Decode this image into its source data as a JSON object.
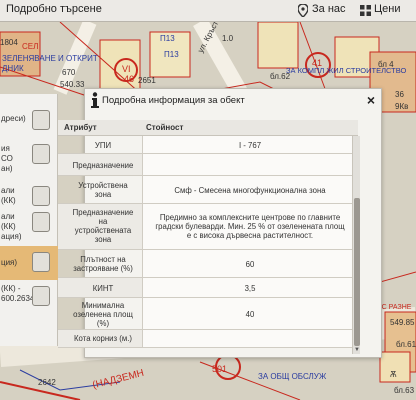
{
  "topbar": {
    "title": "Подробно търсене",
    "about_label": "За нас",
    "prices_label": "Цени"
  },
  "map_labels": {
    "l1": "1804",
    "l2": "СЕЛ",
    "l3": "ЗЕЛЕНЯВАНЕ И ОТКРИТ",
    "l4": "ДНИК",
    "l5": "670",
    "l6": "540.33",
    "l7": "П13",
    "l8": "П13",
    "l9": "ул. Кръсто Пастух",
    "l10": "VI",
    "l11": "46",
    "l12": "2651",
    "l13": "1.0",
    "l14": "41",
    "l15": "ЗА КОМПЛ ЖИЛ СТРОИТЕЛСТВО",
    "l16": "бл.62",
    "l17": "бл 4",
    "l18": "2642",
    "l19": "(НАДЗЕМН",
    "l20": "501",
    "l21": "ЗА ОБЩ ОБСЛУЖ",
    "l22": "Ѫ",
    "l23": "549.85",
    "l24": "бл.61",
    "l25": "НЕ С РАЗНЕ",
    "l26": "бл.63",
    "l27": "36",
    "l28": "9Кв"
  },
  "left_panel": {
    "items": [
      {
        "lines": [
          "дреси)"
        ]
      },
      {
        "lines": [
          "ия",
          "СО",
          "ан)"
        ]
      },
      {
        "lines": [
          "али",
          "(КК)"
        ]
      },
      {
        "lines": [
          "али",
          "(КК)",
          "ация)"
        ]
      },
      {
        "lines": [
          "ция)"
        ]
      },
      {
        "lines": [
          "(КК) -",
          "600.2634"
        ]
      }
    ]
  },
  "dialog": {
    "title": "Подробна информация за обект",
    "close": "×",
    "col_attr": "Атрибут",
    "col_val": "Стойност",
    "rows": [
      {
        "attr": [
          "УПИ"
        ],
        "value": [
          "I - 767"
        ]
      },
      {
        "attr": [
          "Предназначение"
        ],
        "value": [
          ""
        ]
      },
      {
        "attr": [
          "Устройствена",
          "зона"
        ],
        "value": [
          "Смф - Смесена многофункционална зона"
        ]
      },
      {
        "attr": [
          "Предназначение",
          "на",
          "устройствената",
          "зона"
        ],
        "value": [
          "Предимно за комплексните центрове по главните",
          "градски булеварди. Мин. 25 % от озеленената площ",
          "е с висока дървесна растителност."
        ]
      },
      {
        "attr": [
          "Плътност на",
          "застрояване (%)"
        ],
        "value": [
          "60"
        ]
      },
      {
        "attr": [
          "КИНТ"
        ],
        "value": [
          "3,5"
        ]
      },
      {
        "attr": [
          "Минимална",
          "озеленена площ",
          "(%)"
        ],
        "value": [
          "40"
        ]
      },
      {
        "attr": [
          "Кота корниз (м.)"
        ],
        "value": [
          ""
        ]
      }
    ]
  }
}
